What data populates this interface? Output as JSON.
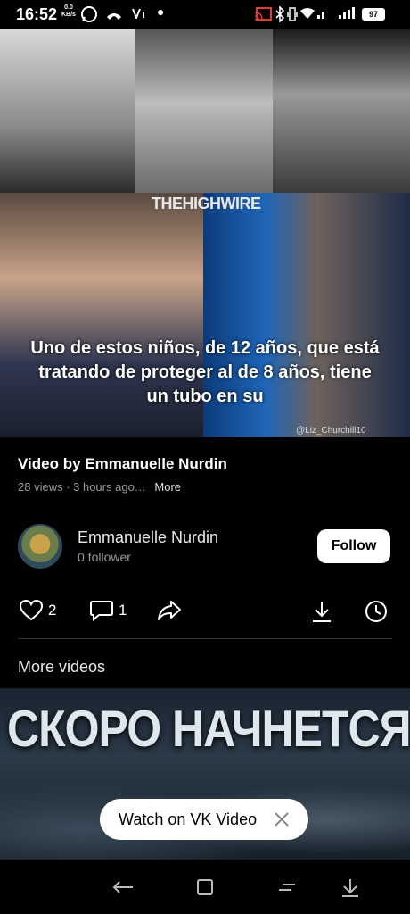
{
  "status_bar": {
    "time": "16:52",
    "net_speed_value": "0.0",
    "net_speed_unit": "KB/s",
    "battery": "97"
  },
  "video": {
    "caption": "Uno de estos niños, de 12 años, que está tratando de proteger al de 8 años, tiene un tubo en su",
    "watermark": "THEHIGHWIRE",
    "handle": "@Liz_Churchill10"
  },
  "info": {
    "title": "Video by Emmanuelle Nurdin",
    "meta": "28 views · 3 hours ago…",
    "more_label": "More"
  },
  "channel": {
    "name": "Emmanuelle Nurdin",
    "followers": "0 follower",
    "follow_label": "Follow"
  },
  "actions": {
    "likes": "2",
    "comments": "1"
  },
  "more_videos": {
    "heading": "More videos",
    "thumb_title": "СКОРО НАЧНЕТСЯ..."
  },
  "vk_banner": {
    "label": "Watch on VK Video"
  },
  "colors": {
    "background": "#000000",
    "muted_text": "#9a9a9a",
    "button_bg": "#ffffff"
  }
}
